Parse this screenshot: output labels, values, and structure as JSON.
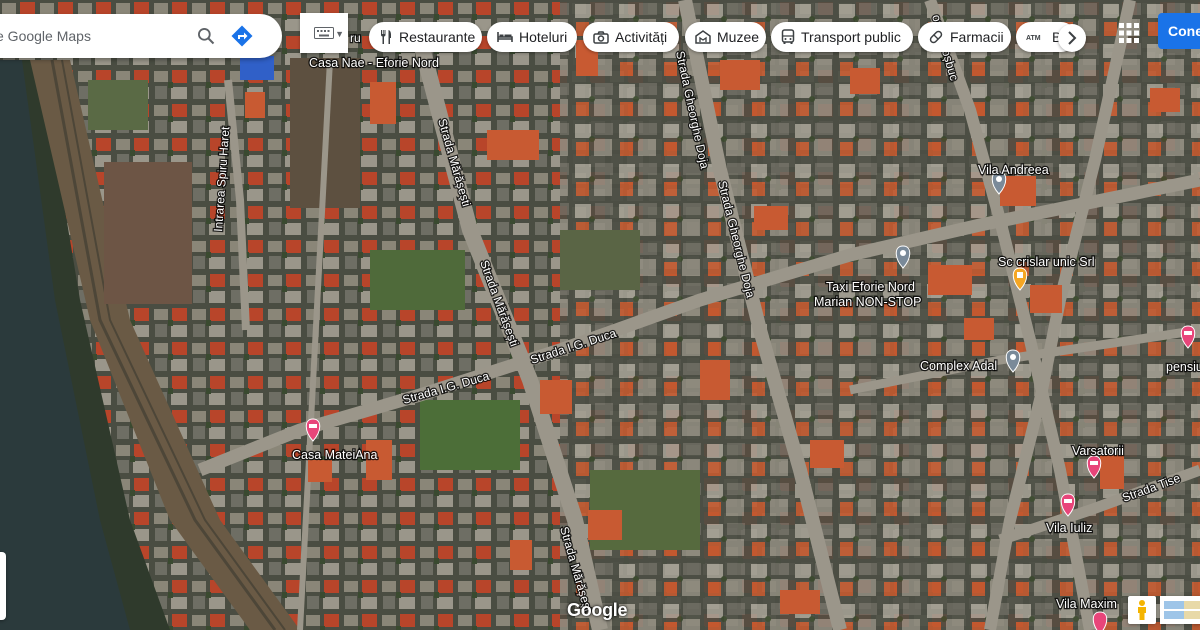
{
  "search": {
    "placeholder": "e Google Maps"
  },
  "chips": [
    {
      "label": "Restaurante",
      "icon": "fork-knife-icon"
    },
    {
      "label": "Hoteluri",
      "icon": "bed-icon"
    },
    {
      "label": "Activități",
      "icon": "camera-icon"
    },
    {
      "label": "Muzee",
      "icon": "museum-icon"
    },
    {
      "label": "Transport public",
      "icon": "bus-icon"
    },
    {
      "label": "Farmacii",
      "icon": "pill-icon"
    },
    {
      "label": "Ba",
      "icon": "atm-icon"
    }
  ],
  "account": {
    "signin_label": "Cone"
  },
  "logo": "Google",
  "colors": {
    "signin": "#1a73e8",
    "directions": "#1a73e8",
    "lodging_pin": "#e8457a",
    "shop_pin": "#f5a623",
    "generic_pin": "#7a8a99"
  },
  "map": {
    "streets": [
      {
        "name": "Strada Mărășești"
      },
      {
        "name": "Strada Mărășești"
      },
      {
        "name": "Strada Mărășeșt"
      },
      {
        "name": "Strada Gheorghe Doja"
      },
      {
        "name": "Strada Gheorghe Doja"
      },
      {
        "name": "Strada I.G. Duca"
      },
      {
        "name": "Strada I.G. Duca"
      },
      {
        "name": "Intrarea Spiru Haret"
      },
      {
        "name": "orge Coșbuc"
      },
      {
        "name": "Strada Tise"
      },
      {
        "name": "ru"
      }
    ],
    "places": [
      {
        "name": "Casa Nae - Eforie Nord",
        "type": "label"
      },
      {
        "name": "Vila Andreea",
        "type": "generic"
      },
      {
        "name": "Taxi Eforie Nord",
        "name2": "Marian NON-STOP",
        "type": "generic"
      },
      {
        "name": "Sc crislar unic Srl",
        "type": "shop"
      },
      {
        "name": "Complex Adal",
        "type": "generic"
      },
      {
        "name": "Casa MateiAna",
        "type": "lodging"
      },
      {
        "name": "Varsatorii",
        "type": "lodging"
      },
      {
        "name": "Vila Iuliz",
        "type": "lodging"
      },
      {
        "name": "Vila Maxim",
        "type": "lodging"
      },
      {
        "name": "pensiu",
        "type": "lodging"
      }
    ]
  }
}
